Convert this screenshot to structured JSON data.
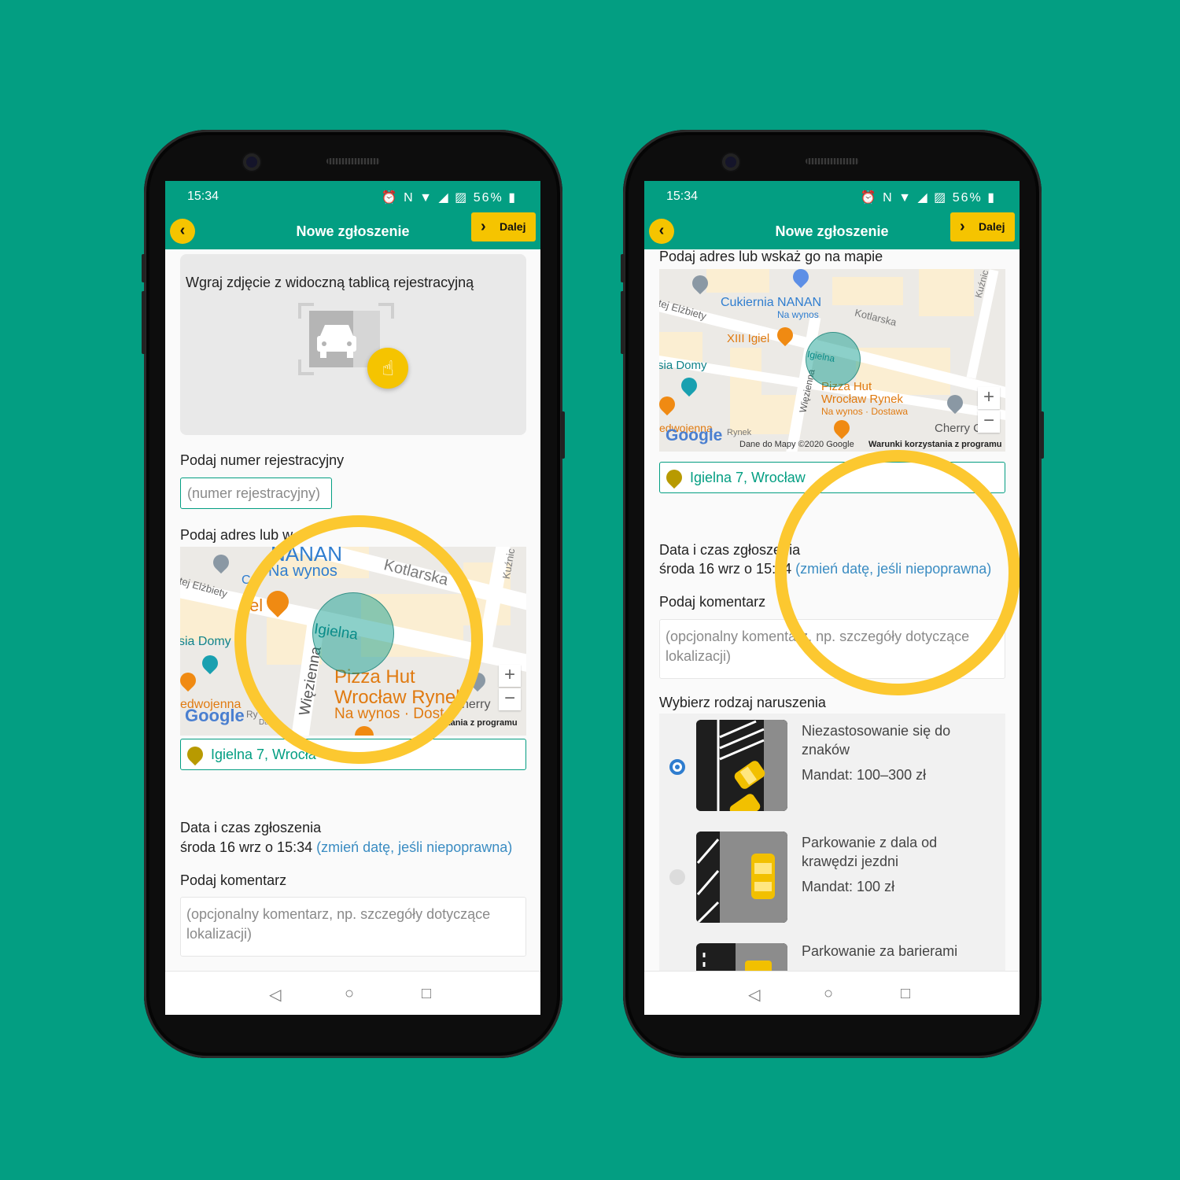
{
  "status": {
    "time": "15:34",
    "icons": "⏰ N ▼ ◢ ▨",
    "battery": "56%"
  },
  "appbar": {
    "title": "Nowe zgłoszenie",
    "next_label": "Dalej"
  },
  "left": {
    "photo_prompt": "Wgraj zdjęcie z widoczną tablicą rejestracyjną",
    "plate_label": "Podaj numer rejestracyjny",
    "plate_placeholder": "(numer rejestracyjny)",
    "address_label": "Podaj adres lub w",
    "address_value": "Igielna 7, Wrocła",
    "date_label": "Data i czas zgłoszenia",
    "date_value": "środa 16 wrz o 15:34",
    "date_link": "(zmień datę, jeśli niepoprawna)",
    "comment_label": "Podaj komentarz",
    "comment_placeholder": "(opcjonalny komentarz, np. szczegóły dotyczące lokalizacji)",
    "map": {
      "nanan": "NANAN",
      "na_wynos": "Na wynos",
      "kotlarska": "Kotlarska",
      "kuznic": "Kuźnic",
      "elzbiety": "tej Elżbiety",
      "sia_domy": "sia Domy",
      "igielna": "Igielna",
      "wiezienna": "Więzienna",
      "pizza1": "Pizza Hut",
      "pizza2": "Wrocław Rynek",
      "pizza3": "Na wynos · Dost",
      "cherry": "herry",
      "edwojenna": "edwojenna",
      "google": "Google",
      "terms": "tania z programu",
      "c_letter": "C",
      "el_letter": "el",
      "ry": "Ry",
      "da": "Da"
    }
  },
  "right": {
    "address_label": "Podaj adres lub wskaż go na mapie",
    "address_value": "Igielna 7, Wrocław",
    "date_label": "Data i czas zgłoszenia",
    "date_value": "środa 16 wrz o 15:34",
    "date_link": "(zmień datę, jeśli niepoprawna)",
    "comment_label": "Podaj komentarz",
    "comment_placeholder": "(opcjonalny komentarz, np. szczegóły dotyczące lokalizacji)",
    "violation_label": "Wybierz rodzaj naruszenia",
    "violations": [
      {
        "title": "Niezastosowanie się do znaków",
        "fine": "Mandat: 100–300 zł",
        "selected": true
      },
      {
        "title": "Parkowanie z dala od krawędzi jezdni",
        "fine": "Mandat: 100 zł",
        "selected": false
      },
      {
        "title": "Parkowanie za barierami",
        "fine": "",
        "selected": false
      }
    ],
    "map": {
      "cukiernia": "Cukiernia NANAN",
      "na_wynos": "Na wynos",
      "kotlarska": "Kotlarska",
      "kuznic": "Kuźnic",
      "elzbiety": "tej Elżbiety",
      "xiii": "XIII Igiel",
      "sia_domy": "sia Domy",
      "igielna": "Igielna",
      "wiezienna": "Więzienna",
      "pizza1": "Pizza Hut",
      "pizza2": "Wrocław Rynek",
      "pizza3": "Na wynos · Dostawa",
      "cherry": "Cherry C",
      "edwojenna": "edwojenna",
      "google": "Google",
      "rynek": "Rynek",
      "data_credit": "Dane do Mapy ©2020 Google",
      "terms": "Warunki korzystania z programu"
    }
  }
}
